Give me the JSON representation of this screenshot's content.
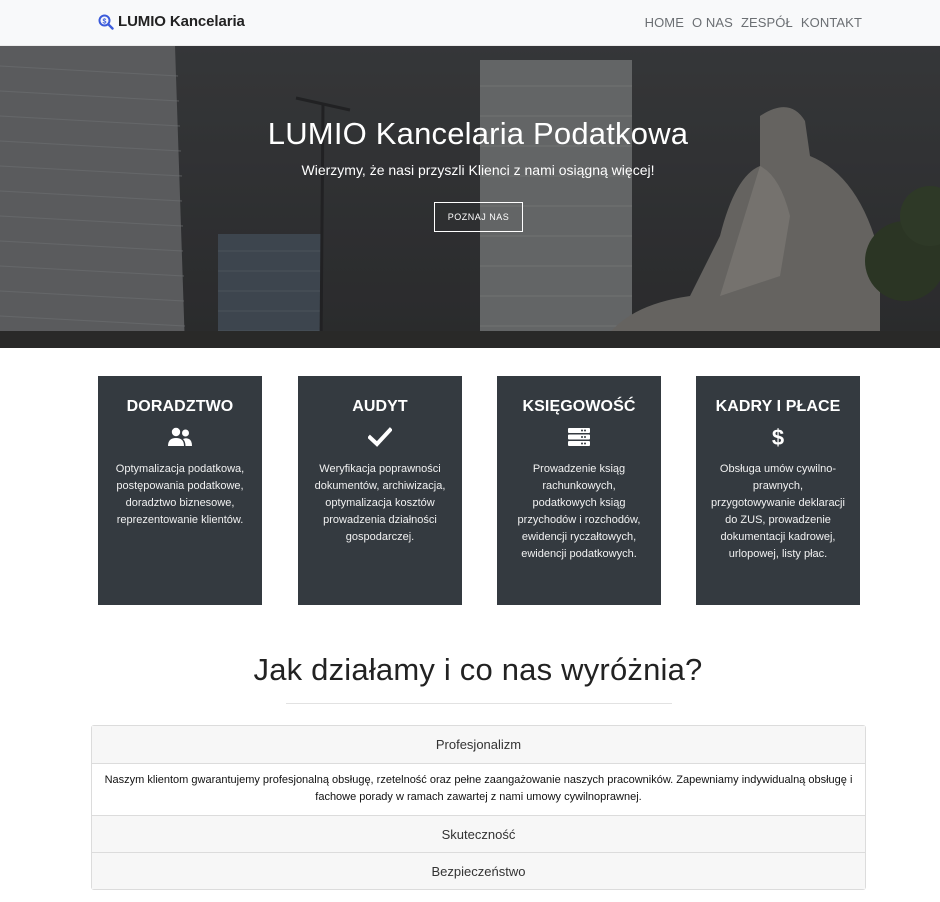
{
  "navbar": {
    "brand": "LUMIO Kancelaria",
    "links": [
      "HOME",
      "O NAS",
      "ZESPÓŁ",
      "KONTAKT"
    ]
  },
  "hero": {
    "title": "LUMIO Kancelaria Podatkowa",
    "subtitle": "Wierzymy, że nasi przyszli Klienci z nami osiągną więcej!",
    "button": "POZNAJ NAS"
  },
  "services": [
    {
      "title": "DORADZTWO",
      "icon": "users-icon",
      "text": "Optymalizacja podatkowa, postępowania podatkowe, doradztwo biznesowe, reprezentowanie klientów."
    },
    {
      "title": "AUDYT",
      "icon": "check-icon",
      "text": "Weryfikacja poprawności dokumentów, archiwizacja, optymalizacja kosztów prowadzenia działności gospodarczej."
    },
    {
      "title": "KSIĘGOWOŚĆ",
      "icon": "server-icon",
      "text": "Prowadzenie ksiąg rachunkowych, podatkowych ksiąg przychodów i rozchodów, ewidencji ryczałtowych, ewidencji podatkowych."
    },
    {
      "title": "KADRY I PŁACE",
      "icon": "dollar-icon",
      "text": "Obsługa umów cywilno-prawnych, przygotowywanie deklaracji do ZUS, prowadzenie dokumentacji kadrowej, urlopowej, listy płac."
    }
  ],
  "section": {
    "title": "Jak działamy i co nas wyróżnia?"
  },
  "accordion": [
    {
      "header": "Profesjonalizm",
      "body": "Naszym klientom gwarantujemy profesjonalną obsługę, rzetelność oraz pełne zaangażowanie naszych pracowników. Zapewniamy indywidualną obsługę i fachowe porady w ramach zawartej z nami umowy cywilnoprawnej."
    },
    {
      "header": "Skuteczność"
    },
    {
      "header": "Bezpieczeństwo"
    }
  ],
  "colors": {
    "card_bg": "#343a40",
    "navbar_bg": "#f8f9fa",
    "brand_icon": "#3b5bdb"
  }
}
